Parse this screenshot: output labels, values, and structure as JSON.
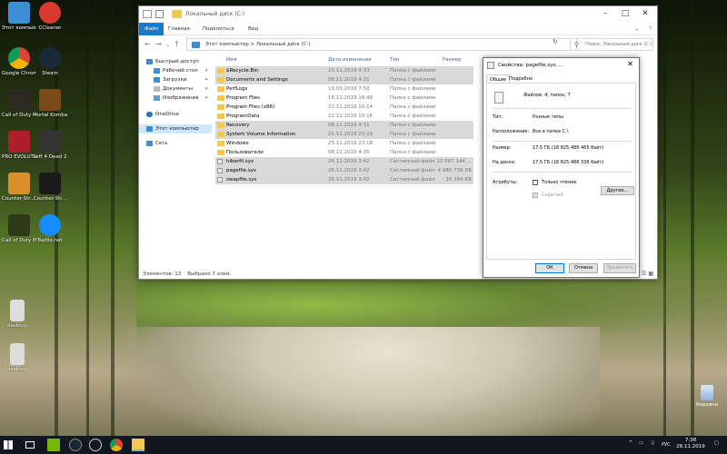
{
  "desktop": {
    "icons": [
      {
        "label": "Этот компьютер"
      },
      {
        "label": "CCleaner"
      },
      {
        "label": "Google Chrome"
      },
      {
        "label": "Steam"
      },
      {
        "label": "Call of Duty Modern ..."
      },
      {
        "label": "Mortal Kombat 11"
      },
      {
        "label": "PRO EVOLUTIO..."
      },
      {
        "label": "Left 4 Dead 2"
      },
      {
        "label": "Counter-Str... Global Offe..."
      },
      {
        "label": "Counter-Str..."
      },
      {
        "label": "Call of Duty Modern ..."
      },
      {
        "label": "Battle.net"
      },
      {
        "label": "desktop"
      },
      {
        "label": "desktop"
      }
    ],
    "recycle_bin": "Корзина"
  },
  "explorer": {
    "title": "Локальный диск (C:)",
    "ribbon_tabs": [
      "Файл",
      "Главная",
      "Поделиться",
      "Вид"
    ],
    "breadcrumb": "Этот компьютер  >  Локальный диск (C:)",
    "search_placeholder": "Поиск: Локальный диск (C:)",
    "nav_items": [
      {
        "label": "Быстрый доступ",
        "pinned": false
      },
      {
        "label": "Рабочий стол",
        "pinned": true
      },
      {
        "label": "Загрузки",
        "pinned": true
      },
      {
        "label": "Документы",
        "pinned": true
      },
      {
        "label": "Изображения",
        "pinned": true
      },
      {
        "label": "OneDrive",
        "pinned": false
      },
      {
        "label": "Этот компьютер",
        "pinned": false
      },
      {
        "label": "Сеть",
        "pinned": false
      }
    ],
    "columns": [
      "Имя",
      "Дата изменения",
      "Тип",
      "Размер"
    ],
    "files": [
      {
        "name": "$Recycle.Bin",
        "date": "15.11.2019 4:33",
        "type": "Папка с файлами",
        "size": "",
        "selected": true,
        "kind": "folder"
      },
      {
        "name": "Documents and Settings",
        "date": "08.11.2019 4:31",
        "type": "Папка с файлами",
        "size": "",
        "selected": true,
        "kind": "folder"
      },
      {
        "name": "PerfLogs",
        "date": "19.03.2019 7:52",
        "type": "Папка с файлами",
        "size": "",
        "selected": false,
        "kind": "folder"
      },
      {
        "name": "Program Files",
        "date": "18.11.2019 18:48",
        "type": "Папка с файлами",
        "size": "",
        "selected": false,
        "kind": "folder"
      },
      {
        "name": "Program Files (x86)",
        "date": "22.11.2019 10:14",
        "type": "Папка с файлами",
        "size": "",
        "selected": false,
        "kind": "folder"
      },
      {
        "name": "ProgramData",
        "date": "22.11.2019 10:16",
        "type": "Папка с файлами",
        "size": "",
        "selected": false,
        "kind": "folder"
      },
      {
        "name": "Recovery",
        "date": "08.11.2019 4:31",
        "type": "Папка с файлами",
        "size": "",
        "selected": true,
        "kind": "folder"
      },
      {
        "name": "System Volume Information",
        "date": "25.11.2019 23:19",
        "type": "Папка с файлами",
        "size": "",
        "selected": true,
        "kind": "folder"
      },
      {
        "name": "Windows",
        "date": "25.11.2019 23:18",
        "type": "Папка с файлами",
        "size": "",
        "selected": false,
        "kind": "folder"
      },
      {
        "name": "Пользователи",
        "date": "08.11.2019 4:35",
        "type": "Папка с файлами",
        "size": "",
        "selected": false,
        "kind": "folder"
      },
      {
        "name": "hiberfil.sys",
        "date": "26.11.2019 3:42",
        "type": "Системный файл",
        "size": "12 587 144 ...",
        "selected": true,
        "kind": "sys"
      },
      {
        "name": "pagefile.sys",
        "date": "26.11.2019 3:42",
        "type": "Системный файл",
        "size": "4 980 736 КБ",
        "selected": true,
        "kind": "sys"
      },
      {
        "name": "swapfile.sys",
        "date": "26.11.2019 3:42",
        "type": "Системный файл",
        "size": "16 384 КБ",
        "selected": true,
        "kind": "sys"
      }
    ],
    "status_items": "Элементов: 13",
    "status_selected": "Выбрано 7 элем."
  },
  "properties": {
    "title": "Свойства: pagefile.sys, ...",
    "tabs": [
      "Общие",
      "Подробно"
    ],
    "summary": "Файлов: 4; папок: 7",
    "rows": [
      {
        "label": "Тип:",
        "value": "Разные типы"
      },
      {
        "label": "Расположение:",
        "value": "Все в папке C:\\"
      },
      {
        "label": "Размер:",
        "value": "17,5 ГБ (18 825 486 465 байт)"
      },
      {
        "label": "На диске:",
        "value": "17,5 ГБ (18 825 486 336 байт)"
      }
    ],
    "attributes_label": "Атрибуты:",
    "readonly_label": "Только чтение",
    "hidden_label": "Скрытый",
    "hidden_checked": true,
    "more_button": "Другие...",
    "ok_button": "ОК",
    "cancel_button": "Отмена",
    "apply_button": "Применить"
  },
  "taskbar": {
    "lang": "РУС",
    "time": "7:38",
    "date": "26.11.2019"
  }
}
